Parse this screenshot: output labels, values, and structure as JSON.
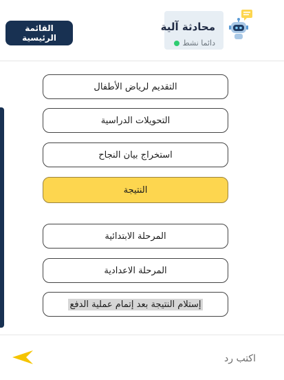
{
  "header": {
    "bot_name": "محادثة آلية",
    "status": "دائما نشط",
    "home_button": "القائمة الرئيسية"
  },
  "options": [
    {
      "label": "التقديم لرياض الأطفال",
      "state": "default"
    },
    {
      "label": "التحويلات الدراسية",
      "state": "default"
    },
    {
      "label": "استخراج بيان النجاح",
      "state": "default"
    },
    {
      "label": "النتيجة",
      "state": "selected"
    },
    {
      "label": "المرحلة الابتدائية",
      "state": "default"
    },
    {
      "label": "المرحلة الاعدادية",
      "state": "default"
    },
    {
      "label": "إستلام النتيجة بعد إتمام عملية الدفع",
      "state": "highlighted"
    }
  ],
  "footer": {
    "reply_placeholder": "اكتب رد"
  },
  "colors": {
    "brand": "#183152",
    "selected": "#fdd64f",
    "send_arrow": "#f5c400",
    "status_online": "#2ecc71"
  },
  "icons": {
    "bot": "robot-avatar-icon",
    "send": "send-arrow-icon"
  }
}
